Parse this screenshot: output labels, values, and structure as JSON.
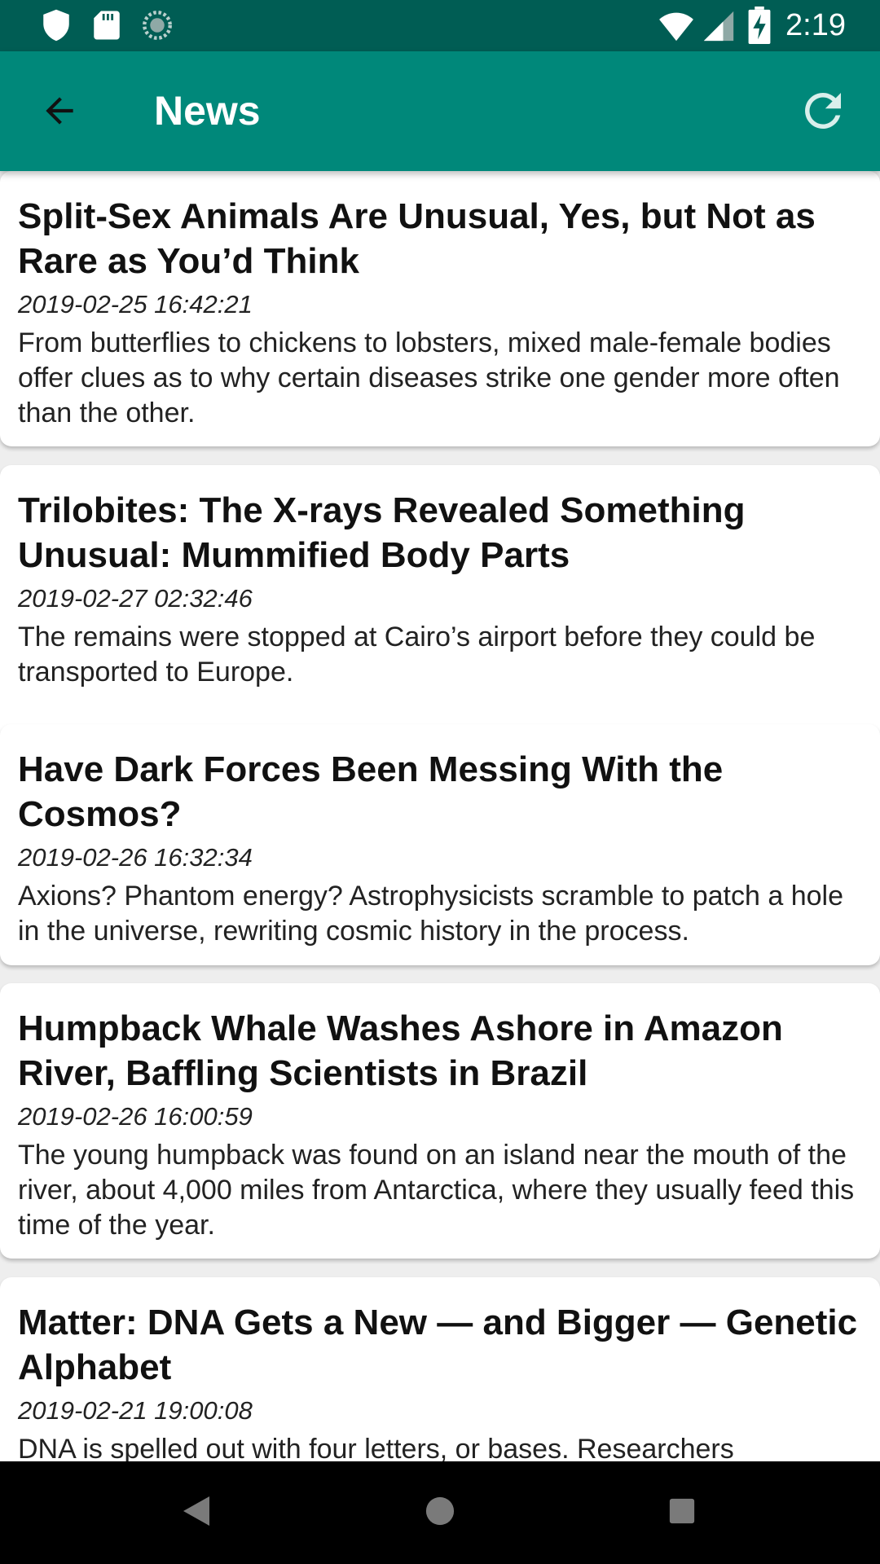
{
  "status_bar": {
    "time": "2:19",
    "icons": [
      "shield-icon",
      "sd-card-icon",
      "sync-icon",
      "wifi-icon",
      "cellular-signal-icon",
      "battery-charging-icon"
    ]
  },
  "app_bar": {
    "title": "News",
    "back_icon": "arrow-back-icon",
    "refresh_icon": "refresh-icon"
  },
  "news": [
    {
      "title": "Split-Sex Animals Are Unusual, Yes, but Not as Rare as You’d Think",
      "date": "2019-02-25 16:42:21",
      "description": "From butterflies to chickens to lobsters, mixed male-female bodies offer clues as to why certain diseases strike one gender more often than the other."
    },
    {
      "title": "Trilobites: The X-rays Revealed Something Unusual: Mummified Body Parts",
      "date": "2019-02-27 02:32:46",
      "description": "The remains were stopped at Cairo’s airport before they could be transported to Europe."
    },
    {
      "title": "Have Dark Forces Been Messing With the Cosmos?",
      "date": "2019-02-26 16:32:34",
      "description": "Axions? Phantom energy? Astrophysicists scramble to patch a hole in the universe, rewriting cosmic history in the process."
    },
    {
      "title": "Humpback Whale Washes Ashore in Amazon River, Baffling Scientists in Brazil",
      "date": "2019-02-26 16:00:59",
      "description": "The young humpback was found on an island near the mouth of the river, about 4,000 miles from Antarctica, where they usually feed this time of the year."
    },
    {
      "title": "Matter: DNA Gets a New — and Bigger — Genetic Alphabet",
      "date": "2019-02-21 19:00:08",
      "description": "DNA is spelled out with four letters, or bases. Researchers"
    }
  ],
  "nav_bar": {
    "back_icon": "nav-back-icon",
    "home_icon": "nav-home-icon",
    "recents_icon": "nav-recents-icon"
  },
  "colors": {
    "status_bar": "#005d54",
    "app_bar": "#00887a",
    "background": "#eeeeee",
    "card": "#ffffff"
  }
}
